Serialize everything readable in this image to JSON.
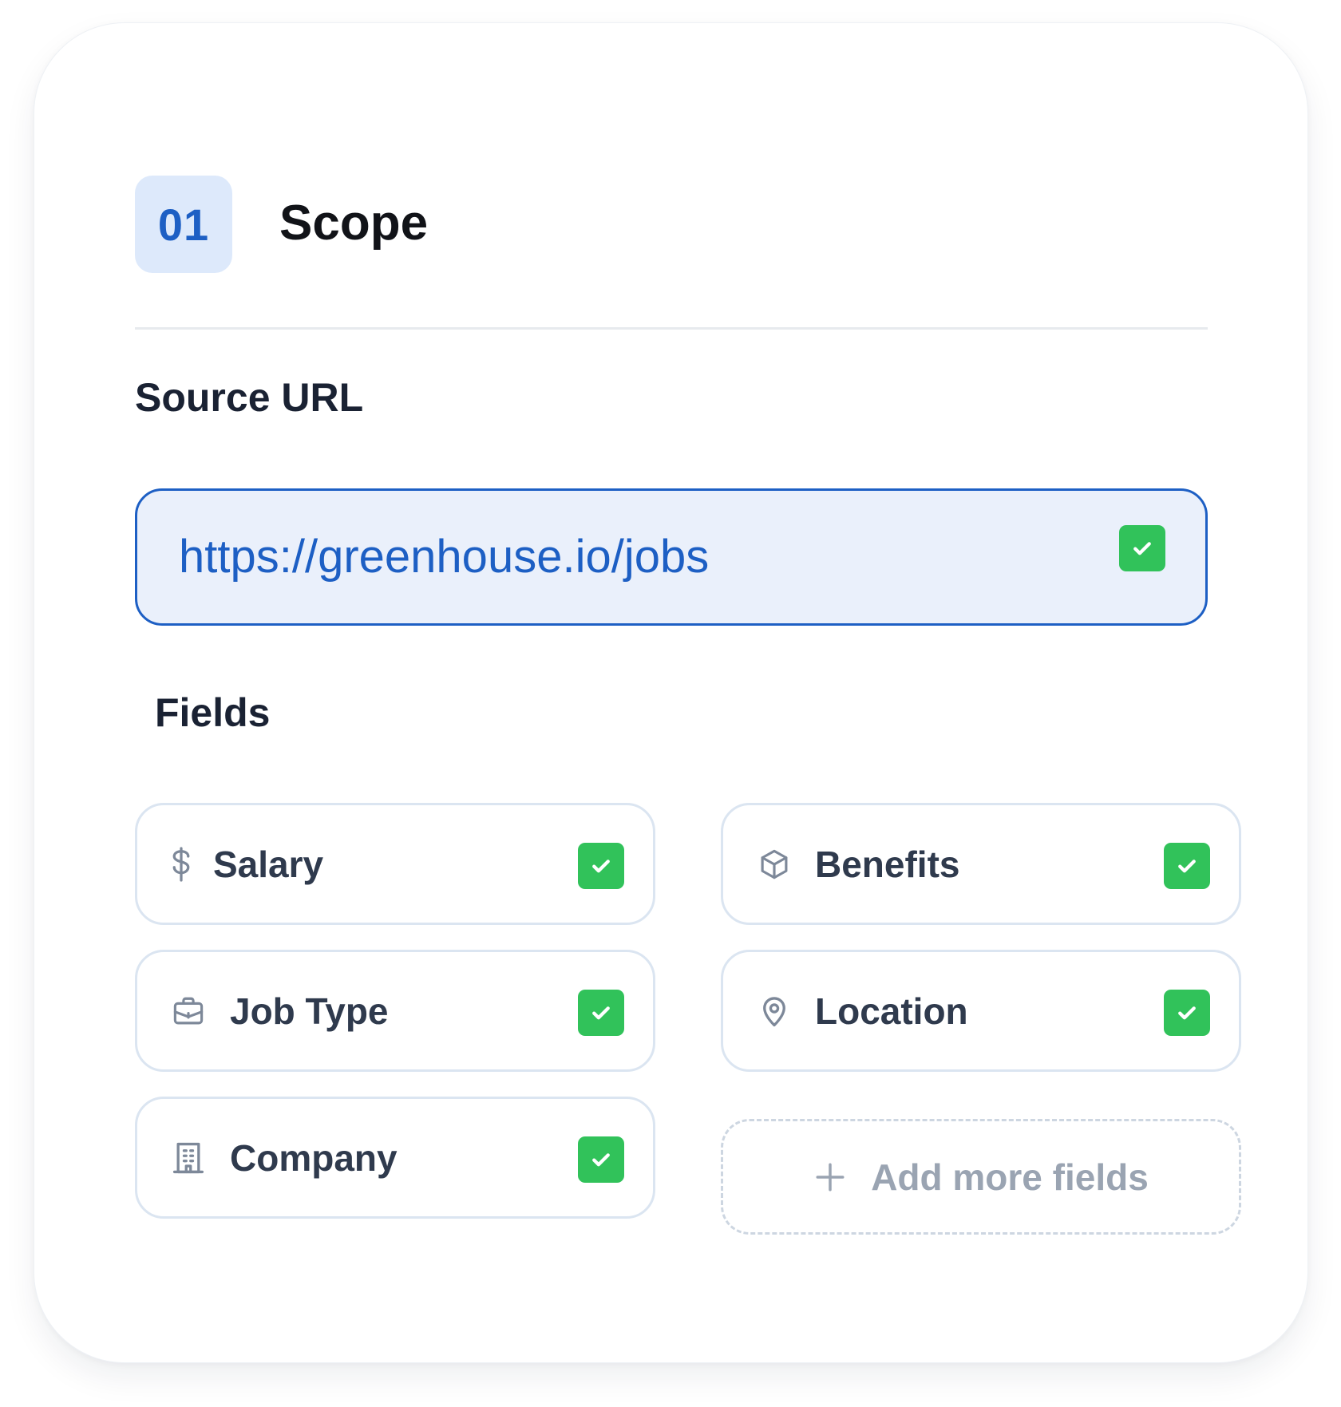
{
  "theme": {
    "accent": "#1d5fc4",
    "badge_bg": "#dde9fb",
    "url_bg": "#eaf0fb",
    "check_green": "#31c25a"
  },
  "step": {
    "number": "01",
    "title": "Scope"
  },
  "source": {
    "label": "Source URL",
    "url": "https://greenhouse.io/jobs",
    "verified": true
  },
  "fields": {
    "label": "Fields",
    "items": [
      {
        "label": "Salary",
        "icon": "dollar-icon",
        "checked": true
      },
      {
        "label": "Benefits",
        "icon": "box-icon",
        "checked": true
      },
      {
        "label": "Job Type",
        "icon": "briefcase-icon",
        "checked": true
      },
      {
        "label": "Location",
        "icon": "map-pin-icon",
        "checked": true
      },
      {
        "label": "Company",
        "icon": "building-icon",
        "checked": true
      }
    ],
    "add_more_label": "Add more fields",
    "add_icon": "plus-icon"
  }
}
